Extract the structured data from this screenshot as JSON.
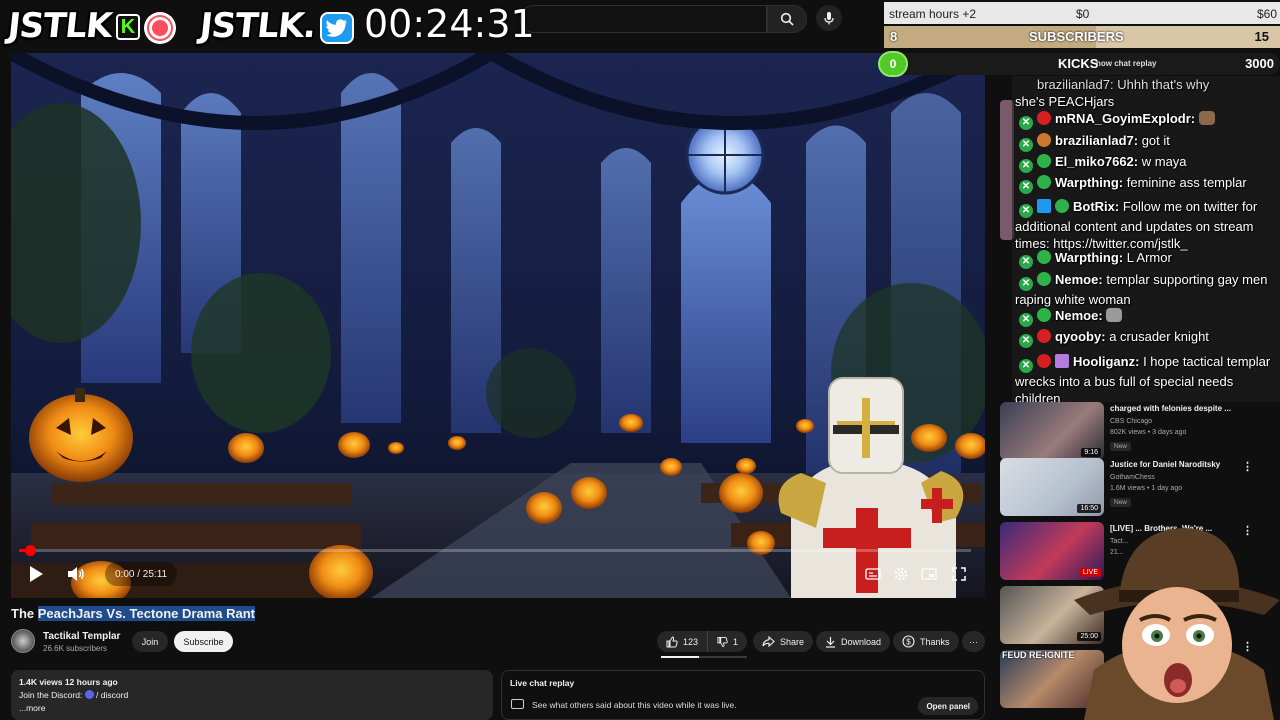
{
  "overlay": {
    "brand1": "JSTLK",
    "brand2": "JSTLK",
    "timer": "00:24:31",
    "goals": {
      "row1_label": "stream hours +2",
      "row1_mid": "$0",
      "row1_right": "$60",
      "subs_count": "8",
      "subs_label": "SUBSCRIBERS",
      "subs_goal": "15",
      "kicks_count": "0",
      "kicks_label": "KICKS",
      "kicks_note": "now chat replay",
      "kicks_goal": "3000"
    }
  },
  "player": {
    "time": "0:00 / 25:11",
    "progress": 0.012
  },
  "video": {
    "title_prefix": "The ",
    "title_selected": "PeachJars Vs. Tectone Drama Rant",
    "channel_name": "Tactikal Templar",
    "subscribers": "26.6K subscribers",
    "join_label": "Join",
    "subscribe_label": "Subscribe",
    "like_count": "123",
    "dislike_count": "1",
    "share_label": "Share",
    "download_label": "Download",
    "thanks_label": "Thanks",
    "more_icon": "···"
  },
  "description": {
    "stats": "1.4K views  12 hours ago",
    "line2_prefix": "Join the Discord: ",
    "line2_link": "/ discord",
    "more": "...more"
  },
  "live_chat_box": {
    "heading": "Live chat replay",
    "body": "See what others said about this video while it was live.",
    "button": "Open panel"
  },
  "chat": {
    "messages": [
      {
        "user": "",
        "text": "she's PEACHjars",
        "prefix": "brazilianlad7: Uhhh that's why",
        "dot": "#c97a2e"
      },
      {
        "user": "mRNA_GoyimExplodr:",
        "text": "",
        "dot": "#d62020",
        "emote": true
      },
      {
        "user": "brazilianlad7:",
        "text": "got it",
        "dot": "#c97a2e"
      },
      {
        "user": "El_miko7662:",
        "text": "w maya",
        "dot": "#2db34a"
      },
      {
        "user": "Warpthing:",
        "text": "feminine ass templar",
        "dot": "#2db34a"
      },
      {
        "user": "BotRix:",
        "text": "Follow me on twitter for additional content and updates on stream times: https://twitter.com/jstlk_",
        "dot": "#1d9bf0"
      },
      {
        "user": "Warpthing:",
        "text": "L Armor",
        "dot": "#2db34a"
      },
      {
        "user": "Nemoe:",
        "text": "templar supporting gay men raping white woman",
        "dot": "#2db34a"
      },
      {
        "user": "Nemoe:",
        "text": "",
        "dot": "#2db34a",
        "emote": true
      },
      {
        "user": "qyooby:",
        "text": "a crusader knight",
        "dot": "#d62020"
      },
      {
        "user": "Hooliganz:",
        "text": "I hope tactical templar wrecks into a bus full of special needs children",
        "dot": "#d62020"
      }
    ]
  },
  "recommendations": [
    {
      "title": "charged with felonies despite ...",
      "channel": "CBS Chicago",
      "meta": "802K views • 3 days ago",
      "badge": "New",
      "duration": "9:16"
    },
    {
      "title": "Justice for Daniel Naroditsky",
      "channel": "GothamChess",
      "meta": "1.6M views • 1 day ago",
      "badge": "New",
      "duration": "16:50"
    },
    {
      "title": "[LIVE] ... Brothers. We're ...",
      "channel": "Tact...",
      "meta": "21...",
      "badge": "",
      "duration": "LIVE"
    },
    {
      "title": "",
      "channel": "",
      "meta": "",
      "badge": "",
      "duration": "25:00"
    },
    {
      "title": "",
      "channel": "",
      "meta": "",
      "badge": "",
      "duration": "FEUD RE-IGNITE"
    }
  ],
  "colors": {
    "yt_bg": "#0f0f0f",
    "kick_green": "#53fc18",
    "twitter_blue": "#1d9bf0",
    "subs_bar": "#c3aa80"
  }
}
